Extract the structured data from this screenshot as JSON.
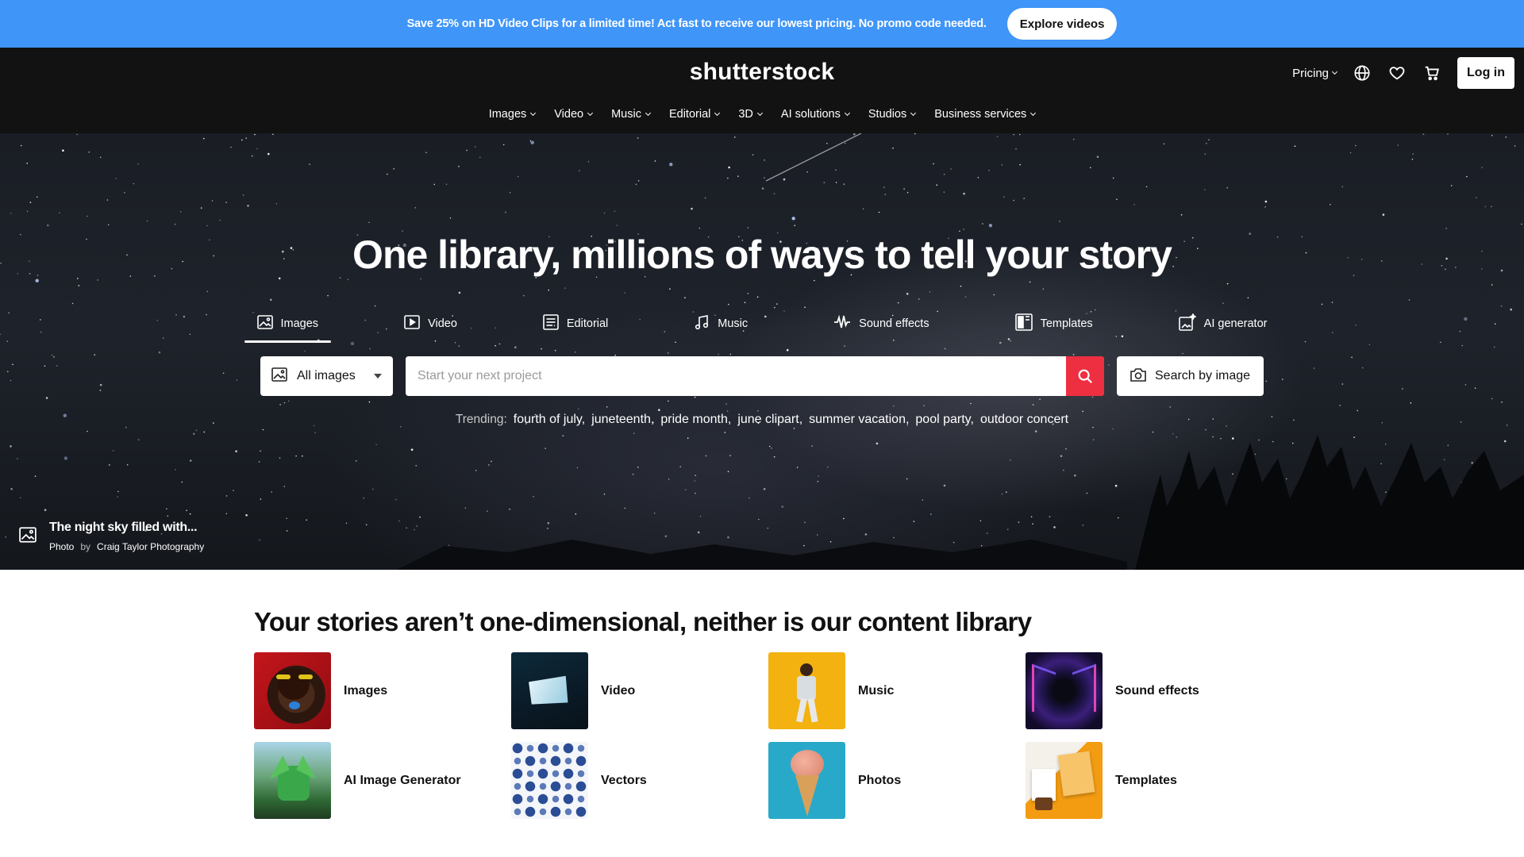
{
  "promo": {
    "text": "Save 25% on HD Video Clips for a limited time! Act fast to receive our lowest pricing. No promo code needed.",
    "button": "Explore videos"
  },
  "header": {
    "logo": "shutterstock",
    "pricing": "Pricing",
    "login": "Log in",
    "nav": [
      "Images",
      "Video",
      "Music",
      "Editorial",
      "3D",
      "AI solutions",
      "Studios",
      "Business services"
    ]
  },
  "hero": {
    "title": "One library, millions of ways to tell your story",
    "tabs": [
      {
        "label": "Images",
        "icon": "image-icon",
        "active": true
      },
      {
        "label": "Video",
        "icon": "video-icon"
      },
      {
        "label": "Editorial",
        "icon": "editorial-icon"
      },
      {
        "label": "Music",
        "icon": "music-icon"
      },
      {
        "label": "Sound effects",
        "icon": "sound-wave-icon"
      },
      {
        "label": "Templates",
        "icon": "templates-icon"
      },
      {
        "label": "AI generator",
        "icon": "ai-generator-icon"
      }
    ],
    "scope": "All images",
    "search_placeholder": "Start your next project",
    "search_by_image": "Search by image",
    "trending_label": "Trending:",
    "trending": [
      "fourth of july,",
      "juneteenth,",
      "pride month,",
      "june clipart,",
      "summer vacation,",
      "pool party,",
      "outdoor concert"
    ],
    "credit": {
      "title": "The night sky filled with...",
      "type": "Photo",
      "by": "by",
      "author": "Craig Taylor Photography"
    }
  },
  "content": {
    "title": "Your stories aren’t one-dimensional, neither is our content library",
    "cards": [
      "Images",
      "Video",
      "Music",
      "Sound effects",
      "AI Image Generator",
      "Vectors",
      "Photos",
      "Templates"
    ]
  },
  "colors": {
    "promo": "#3f95f8",
    "header": "#121212",
    "search_button": "#ee2e41"
  }
}
